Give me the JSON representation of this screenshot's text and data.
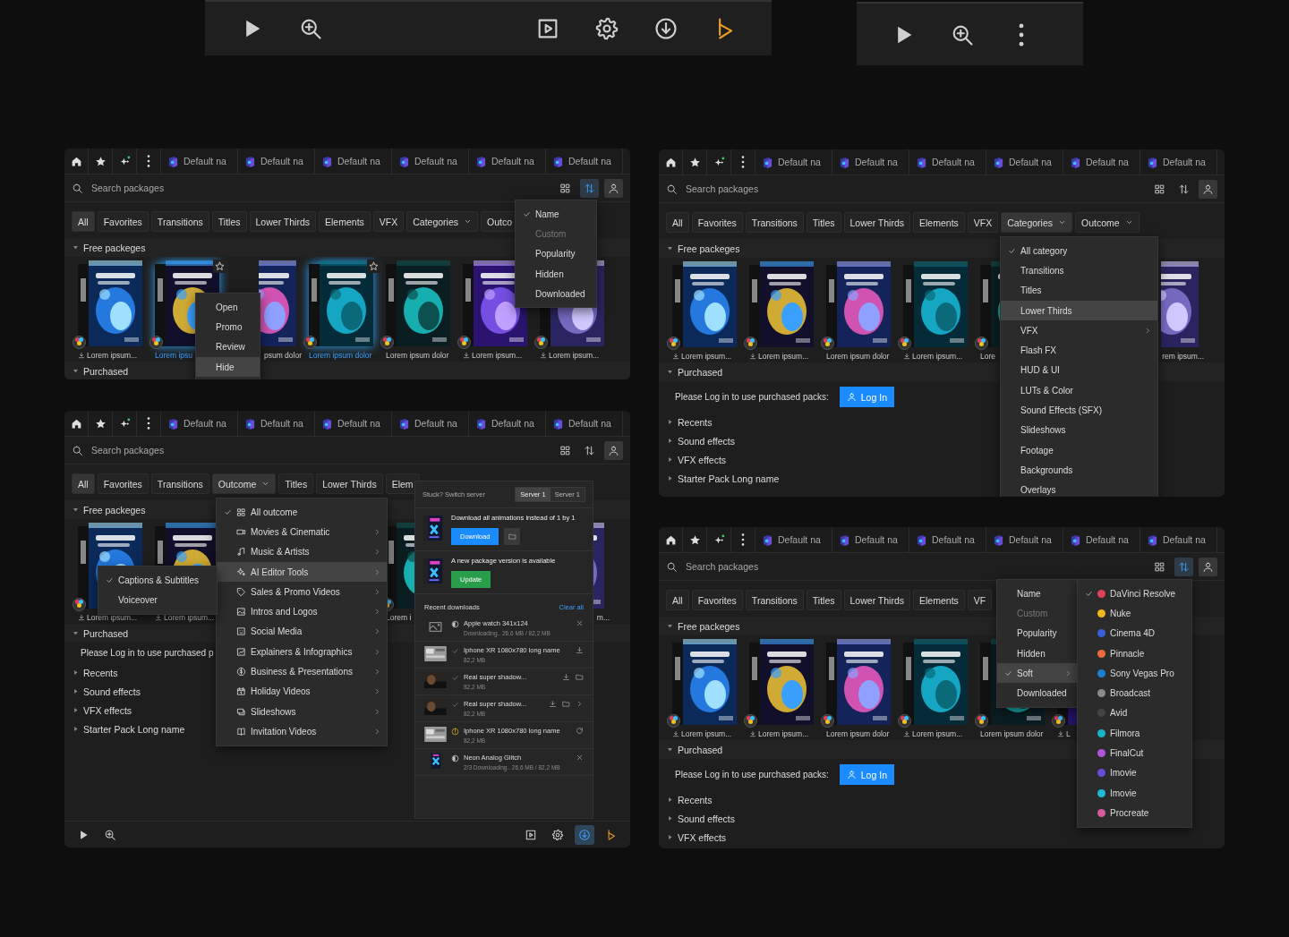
{
  "toolbars": [
    {
      "left": [
        {
          "kind": "play",
          "selected": false
        },
        {
          "kind": "zoom",
          "selected": false
        }
      ],
      "right": [
        {
          "kind": "preview",
          "selected": false
        },
        {
          "kind": "settings",
          "selected": false
        },
        {
          "kind": "download",
          "selected": false
        },
        {
          "kind": "logo",
          "selected": false
        }
      ]
    },
    {
      "left": [
        {
          "kind": "play",
          "selected": false
        },
        {
          "kind": "zoom",
          "selected": false
        },
        {
          "kind": "more",
          "selected": false
        }
      ]
    }
  ],
  "panels": [
    {
      "tabs": [
        "Default na",
        "Default na",
        "Default na",
        "Default na",
        "Default na",
        "Default na"
      ],
      "search": {
        "placeholder": "Search packages"
      },
      "sort_active": true,
      "chips": [
        {
          "label": "All",
          "selected": true,
          "dropdown": false
        },
        {
          "label": "Favorites",
          "selected": false,
          "dropdown": false
        },
        {
          "label": "Transitions",
          "selected": false,
          "dropdown": false
        },
        {
          "label": "Titles",
          "selected": false,
          "dropdown": false
        },
        {
          "label": "Lower Thirds",
          "selected": false,
          "dropdown": false
        },
        {
          "label": "Elements",
          "selected": false,
          "dropdown": false
        },
        {
          "label": "VFX",
          "selected": false,
          "dropdown": false
        },
        {
          "label": "Categories",
          "selected": false,
          "dropdown": true
        },
        {
          "label": "Outco",
          "selected": false,
          "dropdown": false
        }
      ],
      "sections": [
        {
          "title": "Free packeges",
          "expanded": true,
          "kind": "cards"
        },
        {
          "title": "Purchased",
          "expanded": true
        }
      ],
      "cards": [
        {
          "kind": "full",
          "caption": "Lorem ipsum...",
          "download": true,
          "link": false,
          "favorite": false
        },
        {
          "kind": "full",
          "caption": "Lorem ipsu",
          "download": false,
          "link": true,
          "favorite": true
        },
        {
          "kind": "tail",
          "caption": "psum dolor",
          "link": false,
          "favorite": false
        },
        {
          "kind": "full",
          "caption": "Lorem ipsum dolor",
          "download": false,
          "link": true,
          "favorite": true
        },
        {
          "kind": "full",
          "caption": "Lorem ipsum dolor",
          "download": false,
          "link": false,
          "favorite": false
        },
        {
          "kind": "full",
          "caption": "Lorem ipsum...",
          "download": true,
          "link": false,
          "favorite": false
        },
        {
          "kind": "full",
          "caption": "Lorem ipsum...",
          "download": true,
          "link": false,
          "favorite": false
        }
      ],
      "menus": [
        {
          "items": [
            {
              "label": "Name",
              "checked": true,
              "selected": false,
              "disabled": false
            },
            {
              "label": "Custom",
              "checked": false,
              "selected": false,
              "disabled": true
            },
            {
              "label": "Popularity",
              "checked": false,
              "selected": false,
              "disabled": false
            },
            {
              "label": "Hidden",
              "checked": false,
              "selected": false,
              "disabled": false
            },
            {
              "label": "Downloaded",
              "checked": false,
              "selected": false,
              "disabled": false
            }
          ]
        },
        {
          "items": [
            {
              "label": "Open",
              "checked": false,
              "selected": false
            },
            {
              "label": "Promo",
              "checked": false,
              "selected": false
            },
            {
              "label": "Review",
              "checked": false,
              "selected": false
            },
            {
              "label": "Hide",
              "checked": false,
              "selected": true
            }
          ]
        }
      ]
    },
    {
      "tabs": [
        "Default na",
        "Default na",
        "Default na",
        "Default na",
        "Default na",
        "Default na"
      ],
      "search": {
        "placeholder": "Search packages"
      },
      "sort_active": false,
      "chips": [
        {
          "label": "All",
          "selected": false,
          "dropdown": false
        },
        {
          "label": "Favorites",
          "selected": false,
          "dropdown": false
        },
        {
          "label": "Transitions",
          "selected": false,
          "dropdown": false
        },
        {
          "label": "Titles",
          "selected": false,
          "dropdown": false
        },
        {
          "label": "Lower Thirds",
          "selected": false,
          "dropdown": false
        },
        {
          "label": "Elements",
          "selected": false,
          "dropdown": false
        },
        {
          "label": "VFX",
          "selected": false,
          "dropdown": false
        },
        {
          "label": "Categories",
          "selected": true,
          "dropdown": true
        },
        {
          "label": "Outcome",
          "selected": false,
          "dropdown": true
        }
      ],
      "sections": [
        {
          "title": "Free packeges",
          "expanded": true,
          "kind": "cards"
        },
        {
          "title": "Purchased",
          "expanded": true,
          "kind": "login"
        },
        {
          "title": "Recents",
          "expanded": false
        },
        {
          "title": "Sound effects",
          "expanded": false
        },
        {
          "title": "VFX effects",
          "expanded": false
        },
        {
          "title": "Starter Pack Long name",
          "expanded": false
        }
      ],
      "login": {
        "text": "Please Log in to use purchased packs:",
        "button": "Log In"
      },
      "cards": [
        {
          "kind": "full",
          "caption": "Lorem ipsum...",
          "download": true,
          "link": false,
          "favorite": false
        },
        {
          "kind": "full",
          "caption": "Lorem ipsum...",
          "download": true,
          "link": false,
          "favorite": false
        },
        {
          "kind": "full",
          "caption": "Lorem ipsum dolor",
          "download": false,
          "link": false,
          "favorite": false
        },
        {
          "kind": "full",
          "caption": "Lorem ipsum...",
          "download": true,
          "link": false,
          "favorite": false
        },
        {
          "kind": "full",
          "caption": "Lore",
          "download": false,
          "link": false,
          "favorite": false
        },
        {
          "kind": "covered"
        },
        {
          "kind": "tail",
          "caption": "rem ipsum...",
          "link": false,
          "favorite": false
        }
      ],
      "menus": [
        {
          "items": [
            {
              "label": "All category",
              "checked": true,
              "selected": false,
              "submenu": false
            },
            {
              "label": "Transitions",
              "checked": false,
              "selected": false,
              "submenu": false
            },
            {
              "label": "Titles",
              "checked": false,
              "selected": false,
              "submenu": false
            },
            {
              "label": "Lower Thirds",
              "checked": false,
              "selected": true,
              "submenu": false
            },
            {
              "label": "VFX",
              "checked": false,
              "selected": false,
              "submenu": true
            },
            {
              "label": "Flash FX",
              "checked": false,
              "selected": false,
              "submenu": false
            },
            {
              "label": "HUD & UI",
              "checked": false,
              "selected": false,
              "submenu": false
            },
            {
              "label": "LUTs & Color",
              "checked": false,
              "selected": false,
              "submenu": false
            },
            {
              "label": "Sound Effects (SFX)",
              "checked": false,
              "selected": false,
              "submenu": false
            },
            {
              "label": "Slideshows",
              "checked": false,
              "selected": false,
              "submenu": false
            },
            {
              "label": "Footage",
              "checked": false,
              "selected": false,
              "submenu": false
            },
            {
              "label": "Backgrounds",
              "checked": false,
              "selected": false,
              "submenu": false
            },
            {
              "label": "Overlays",
              "checked": false,
              "selected": false,
              "submenu": false
            }
          ]
        }
      ]
    },
    {
      "tabs": [
        "Default na",
        "Default na",
        "Default na",
        "Default na",
        "Default na",
        "Default na"
      ],
      "search": {
        "placeholder": "Search packages"
      },
      "sort_active": false,
      "chips": [
        {
          "label": "All",
          "selected": true,
          "dropdown": false
        },
        {
          "label": "Favorites",
          "selected": false,
          "dropdown": false
        },
        {
          "label": "Transitions",
          "selected": false,
          "dropdown": false
        },
        {
          "label": "Outcome",
          "selected": true,
          "dropdown": true
        },
        {
          "label": "Titles",
          "selected": false,
          "dropdown": false
        },
        {
          "label": "Lower Thirds",
          "selected": false,
          "dropdown": false
        },
        {
          "label": "Elem",
          "selected": false,
          "dropdown": false
        }
      ],
      "sections": [
        {
          "title": "Free packeges",
          "expanded": true,
          "kind": "cards"
        },
        {
          "title": "Purchased",
          "expanded": true,
          "kind": "login"
        },
        {
          "title": "Recents",
          "expanded": false
        },
        {
          "title": "Sound effects",
          "expanded": false
        },
        {
          "title": "VFX effects",
          "expanded": false
        },
        {
          "title": "Starter Pack Long name",
          "expanded": false
        }
      ],
      "login": {
        "text": "Please Log in to use purchased p"
      },
      "cards": [
        {
          "kind": "full",
          "caption": "Lorem ipsum...",
          "download": true,
          "link": false,
          "favorite": false
        },
        {
          "kind": "full",
          "caption": "Lorem ipsum...",
          "download": true,
          "link": false,
          "favorite": false
        },
        {
          "kind": "covered"
        },
        {
          "kind": "covered"
        },
        {
          "kind": "full",
          "caption": "Lorem i",
          "download": false,
          "link": false,
          "favorite": false
        },
        {
          "kind": "covered"
        },
        {
          "kind": "tail",
          "caption": "m...",
          "link": false,
          "favorite": false
        }
      ],
      "menus": [
        {
          "items": [
            {
              "label": "All outcome",
              "checked": true,
              "selected": false,
              "submenu": false
            },
            {
              "label": "Movies & Cinematic",
              "checked": false,
              "selected": false,
              "submenu": true
            },
            {
              "label": "Music & Artists",
              "checked": false,
              "selected": false,
              "submenu": true
            },
            {
              "label": "AI Editor Tools",
              "checked": false,
              "selected": true,
              "submenu": true
            },
            {
              "label": "Sales & Promo Videos",
              "checked": false,
              "selected": false,
              "submenu": true
            },
            {
              "label": "Intros and Logos",
              "checked": false,
              "selected": false,
              "submenu": true
            },
            {
              "label": "Social Media",
              "checked": false,
              "selected": false,
              "submenu": true
            },
            {
              "label": "Explainers & Infographics",
              "checked": false,
              "selected": false,
              "submenu": true
            },
            {
              "label": "Business & Presentations",
              "checked": false,
              "selected": false,
              "submenu": true
            },
            {
              "label": "Holiday Videos",
              "checked": false,
              "selected": false,
              "submenu": true
            },
            {
              "label": "Slideshows",
              "checked": false,
              "selected": false,
              "submenu": true
            },
            {
              "label": "Invitation Videos",
              "checked": false,
              "selected": false,
              "submenu": true
            }
          ]
        },
        {
          "items": [
            {
              "label": "Captions & Subtitles",
              "checked": true,
              "selected": false
            },
            {
              "label": "Voiceover",
              "checked": false,
              "selected": false
            }
          ]
        }
      ],
      "downloads": {
        "server_label": "Stuck? Switch server",
        "servers": [
          {
            "label": "Server 1",
            "selected": true
          },
          {
            "label": "Server 1",
            "selected": false
          }
        ],
        "promos": [
          {
            "text": "Download all animations instead of 1 by 1",
            "button": "Download",
            "kind": "download"
          },
          {
            "text": "A new package version is available",
            "button": "Update",
            "kind": "update"
          }
        ],
        "recent_title": "Recent downloads",
        "clear_label": "Clear all",
        "items": [
          {
            "name": "Apple watch 341x124",
            "detail": "Downloading.. 26,6 MB / 82,2 MB",
            "kind": "progress"
          },
          {
            "name": "Iphone XR 1080x780 long name",
            "detail": "82,2 MB",
            "kind": "done"
          },
          {
            "name": "Real super shadow...",
            "detail": "82,2 MB",
            "kind": "done"
          },
          {
            "name": "Real super shadow...",
            "detail": "82,2 MB",
            "kind": "done"
          },
          {
            "name": "Iphone XR 1080x780 long name",
            "detail": "82,2 MB",
            "kind": "warning"
          },
          {
            "name": "Neon Analog Glitch",
            "detail": "2/3 Downloading.. 26,6 MB / 82,2 MB",
            "kind": "progress"
          }
        ]
      },
      "footer": {
        "left": [
          {
            "kind": "play",
            "selected": false
          },
          {
            "kind": "zoom",
            "selected": false
          }
        ],
        "right": [
          {
            "kind": "preview",
            "selected": false
          },
          {
            "kind": "settings",
            "selected": false
          },
          {
            "kind": "download",
            "selected": true
          },
          {
            "kind": "logo",
            "selected": false
          }
        ]
      }
    },
    {
      "tabs": [
        "Default na",
        "Default na",
        "Default na",
        "Default na",
        "Default na",
        "Default na"
      ],
      "search": {
        "placeholder": "Search packages"
      },
      "sort_active": true,
      "chips": [
        {
          "label": "All",
          "selected": false,
          "dropdown": false
        },
        {
          "label": "Favorites",
          "selected": false,
          "dropdown": false
        },
        {
          "label": "Transitions",
          "selected": false,
          "dropdown": false
        },
        {
          "label": "Titles",
          "selected": false,
          "dropdown": false
        },
        {
          "label": "Lower Thirds",
          "selected": false,
          "dropdown": false
        },
        {
          "label": "Elements",
          "selected": false,
          "dropdown": false
        },
        {
          "label": "VF",
          "selected": false,
          "dropdown": false
        }
      ],
      "sections": [
        {
          "title": "Free packeges",
          "expanded": true,
          "kind": "cards"
        },
        {
          "title": "Purchased",
          "expanded": true,
          "kind": "login"
        },
        {
          "title": "Recents",
          "expanded": false
        },
        {
          "title": "Sound effects",
          "expanded": false
        },
        {
          "title": "VFX effects",
          "expanded": false
        }
      ],
      "login": {
        "text": "Please Log in to use purchased packs:",
        "button": "Log In"
      },
      "cards": [
        {
          "kind": "full",
          "caption": "Lorem ipsum...",
          "download": true,
          "link": false,
          "favorite": false
        },
        {
          "kind": "full",
          "caption": "Lorem ipsum...",
          "download": true,
          "link": false,
          "favorite": false
        },
        {
          "kind": "full",
          "caption": "Lorem ipsum dolor",
          "download": false,
          "link": false,
          "favorite": false
        },
        {
          "kind": "full",
          "caption": "Lorem ipsum...",
          "download": true,
          "link": false,
          "favorite": false
        },
        {
          "kind": "full",
          "caption": "Lorem ipsum dolor",
          "download": false,
          "link": false,
          "favorite": false
        },
        {
          "kind": "full",
          "caption": "L",
          "download": true,
          "link": false,
          "favorite": false
        },
        {
          "kind": "covered"
        }
      ],
      "menus": [
        {
          "items": [
            {
              "label": "Name",
              "checked": false,
              "selected": false,
              "disabled": false,
              "submenu": false
            },
            {
              "label": "Custom",
              "checked": false,
              "selected": false,
              "disabled": true,
              "submenu": false
            },
            {
              "label": "Popularity",
              "checked": false,
              "selected": false,
              "disabled": false,
              "submenu": false
            },
            {
              "label": "Hidden",
              "checked": false,
              "selected": false,
              "disabled": false,
              "submenu": false
            },
            {
              "label": "Soft",
              "checked": true,
              "selected": true,
              "disabled": false,
              "submenu": true
            },
            {
              "label": "Downloaded",
              "checked": false,
              "selected": false,
              "disabled": false,
              "submenu": false
            }
          ]
        },
        {
          "items": [
            {
              "label": "DaVinci Resolve",
              "color": "#e0405a",
              "checked": true,
              "selected": false
            },
            {
              "label": "Nuke",
              "color": "#f2b61c",
              "checked": false,
              "selected": false
            },
            {
              "label": "Cinema 4D",
              "color": "#3a5fd8",
              "checked": false,
              "selected": false
            },
            {
              "label": "Pinnacle",
              "color": "#ef6a3a",
              "checked": false,
              "selected": false
            },
            {
              "label": "Sony Vegas Pro",
              "color": "#1c7fd0",
              "checked": false,
              "selected": false
            },
            {
              "label": "Broadcast",
              "color": "#8a8a8a",
              "checked": false,
              "selected": false
            },
            {
              "label": "Avid",
              "color": "#444444",
              "checked": false,
              "selected": false
            },
            {
              "label": "Filmora",
              "color": "#18b4c8",
              "checked": false,
              "selected": false
            },
            {
              "label": "FinalCut",
              "color": "#b055d8",
              "checked": false,
              "selected": false
            },
            {
              "label": "Imovie",
              "color": "#6a4cd8",
              "checked": false,
              "selected": false
            },
            {
              "label": "Imovie",
              "color": "#22b8d8",
              "checked": false,
              "selected": false
            },
            {
              "label": "Procreate",
              "color": "#d85aa0",
              "checked": false,
              "selected": false
            }
          ]
        }
      ]
    }
  ]
}
